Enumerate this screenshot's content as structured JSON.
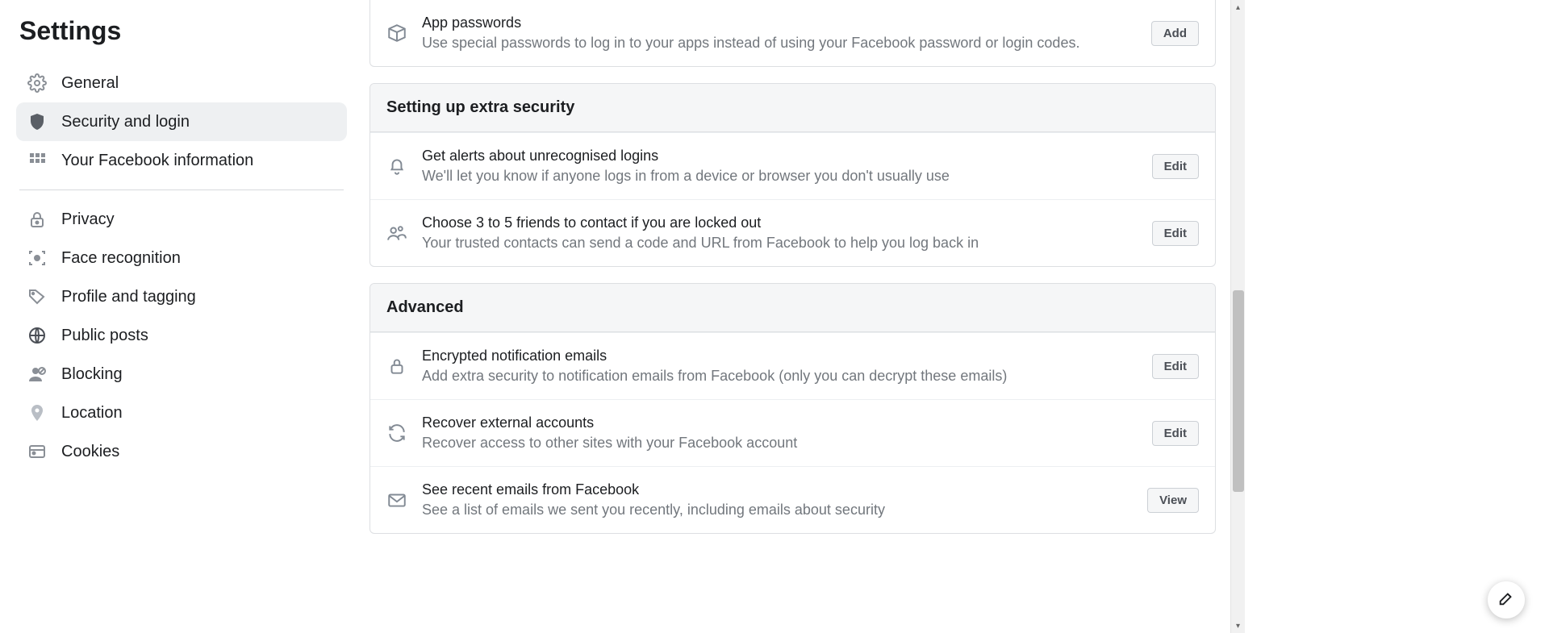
{
  "sidebar": {
    "title": "Settings",
    "items": [
      {
        "label": "General"
      },
      {
        "label": "Security and login"
      },
      {
        "label": "Your Facebook information"
      },
      {
        "label": "Privacy"
      },
      {
        "label": "Face recognition"
      },
      {
        "label": "Profile and tagging"
      },
      {
        "label": "Public posts"
      },
      {
        "label": "Blocking"
      },
      {
        "label": "Location"
      },
      {
        "label": "Cookies"
      }
    ]
  },
  "sections": {
    "top_row": {
      "title": "App passwords",
      "desc": "Use special passwords to log in to your apps instead of using your Facebook password or login codes.",
      "button": "Add"
    },
    "extra_security": {
      "header": "Setting up extra security",
      "alerts": {
        "title": "Get alerts about unrecognised logins",
        "desc": "We'll let you know if anyone logs in from a device or browser you don't usually use",
        "button": "Edit"
      },
      "friends": {
        "title": "Choose 3 to 5 friends to contact if you are locked out",
        "desc": "Your trusted contacts can send a code and URL from Facebook to help you log back in",
        "button": "Edit"
      }
    },
    "advanced": {
      "header": "Advanced",
      "encrypted": {
        "title": "Encrypted notification emails",
        "desc": "Add extra security to notification emails from Facebook (only you can decrypt these emails)",
        "button": "Edit"
      },
      "recover": {
        "title": "Recover external accounts",
        "desc": "Recover access to other sites with your Facebook account",
        "button": "Edit"
      },
      "recent_emails": {
        "title": "See recent emails from Facebook",
        "desc": "See a list of emails we sent you recently, including emails about security",
        "button": "View"
      }
    }
  }
}
